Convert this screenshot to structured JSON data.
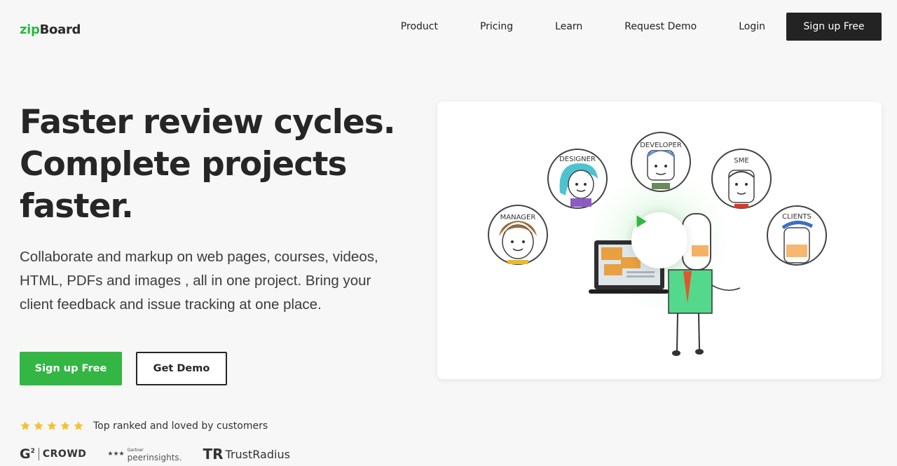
{
  "brand": {
    "zip": "zip",
    "board": "Board"
  },
  "nav": {
    "items": [
      "Product",
      "Pricing",
      "Learn",
      "Request Demo",
      "Login"
    ],
    "cta": "Sign up Free"
  },
  "hero": {
    "title_lines": [
      "Faster review cycles.",
      "Complete projects",
      "faster."
    ],
    "description": "Collaborate and markup on web pages, courses, videos, HTML, PDFs and images , all in one project. Bring your client feedback and issue tracking at one place.",
    "primary_cta": "Sign up Free",
    "secondary_cta": "Get Demo"
  },
  "rating": {
    "stars": 5,
    "text": "Top ranked and loved by customers"
  },
  "badges": {
    "g2_mark": "G",
    "g2_text": "CROWD",
    "gartner_stars": "★★★",
    "gartner_small": "Gartner",
    "gartner_text": "peerinsights.",
    "trustradius_mark": "TR",
    "trustradius_text": "TrustRadius"
  },
  "video": {
    "roles": [
      "MANAGER",
      "DESIGNER",
      "DEVELOPER",
      "SME",
      "CLIENTS"
    ]
  },
  "colors": {
    "brand_green": "#2db742",
    "dark": "#232323",
    "star": "#f2c12e"
  }
}
